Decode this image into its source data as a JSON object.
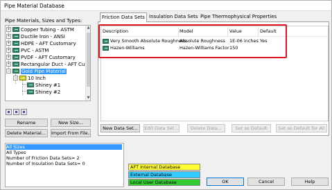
{
  "window": {
    "title": "Pipe Material Database"
  },
  "left_panel": {
    "label": "Pipe Materials, Sizes and Types:",
    "tree": [
      {
        "label": "Copper Tubing - ASTM",
        "expander": "+"
      },
      {
        "label": "Ductile Iron - ANSI",
        "expander": "+"
      },
      {
        "label": "HDPE - AFT Customary",
        "expander": "+"
      },
      {
        "label": "PVC - ASTM",
        "expander": "+"
      },
      {
        "label": "PVDF - AFT Customary",
        "expander": "+"
      },
      {
        "label": "Rectangular Duct - AFT Cu",
        "expander": "+"
      },
      {
        "label": "Gold Pipe Material",
        "expander": "−"
      },
      {
        "label": "10 Inch",
        "expander": "−"
      },
      {
        "label": "Shiney #1"
      },
      {
        "label": "Shiney #2"
      }
    ],
    "buttons": {
      "rename": "Rename",
      "new_size": "New Size...",
      "delete_material": "Delete Material...",
      "import_from_file": "Import From File..."
    }
  },
  "tabs": [
    {
      "label": "Friction Data Sets",
      "active": true
    },
    {
      "label": "Insulation Data Sets",
      "active": false
    },
    {
      "label": "Pipe Thermophysical Properties",
      "active": false
    }
  ],
  "table": {
    "columns": [
      "Description",
      "Model",
      "Value",
      "Default"
    ],
    "rows": [
      {
        "description": "Very Smooth Absolute Roughness",
        "model": "Absolute Roughness",
        "value": "1E-06 inches",
        "default": "Yes"
      },
      {
        "description": "Hazen-Williams",
        "model": "Hazen-Williams Factor",
        "value": "150",
        "default": ""
      }
    ]
  },
  "data_set_buttons": {
    "new": "New Data Set...",
    "edit": "Edit Data Set...",
    "delete": "Delete Data...",
    "set_default": "Set as Default",
    "set_default_all": "Set as Default for All"
  },
  "status_list": {
    "lines": [
      "All Sizes",
      "All Types",
      "Number of Friction Data Sets= 2",
      "Number of Insulation Data Sets= 0"
    ]
  },
  "legend": [
    {
      "label": "AFT Internal Database",
      "color": "#ffff33"
    },
    {
      "label": "External Database",
      "color": "#33ccff"
    },
    {
      "label": "Local User Database",
      "color": "#33cc33"
    }
  ],
  "dialog_buttons": {
    "ok": "OK",
    "cancel": "Cancel",
    "help": "Help"
  },
  "colors": {
    "selection": "#3399ff",
    "highlight_box": "#e0141e"
  }
}
